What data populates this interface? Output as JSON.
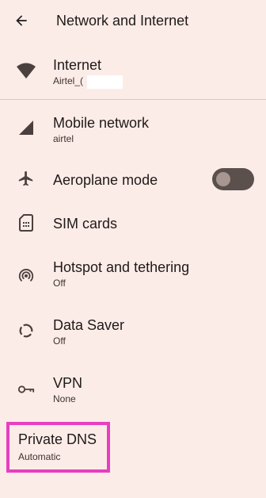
{
  "header": {
    "title": "Network and Internet",
    "back_icon": "arrow-back-icon"
  },
  "items": [
    {
      "label": "Internet",
      "sub": "Airtel_(",
      "icon": "wifi-icon"
    },
    {
      "label": "Mobile network",
      "sub": "airtel",
      "icon": "signal-icon"
    },
    {
      "label": "Aeroplane mode",
      "icon": "airplane-icon",
      "toggle": false
    },
    {
      "label": "SIM cards",
      "icon": "sim-card-icon"
    },
    {
      "label": "Hotspot and tethering",
      "sub": "Off",
      "icon": "hotspot-icon"
    },
    {
      "label": "Data Saver",
      "sub": "Off",
      "icon": "data-saver-icon"
    },
    {
      "label": "VPN",
      "sub": "None",
      "icon": "vpn-key-icon"
    },
    {
      "label": "Private DNS",
      "sub": "Automatic"
    }
  ],
  "colors": {
    "background": "#fcece8",
    "highlight": "#e83ec0",
    "toggle_track": "#5b504c"
  }
}
